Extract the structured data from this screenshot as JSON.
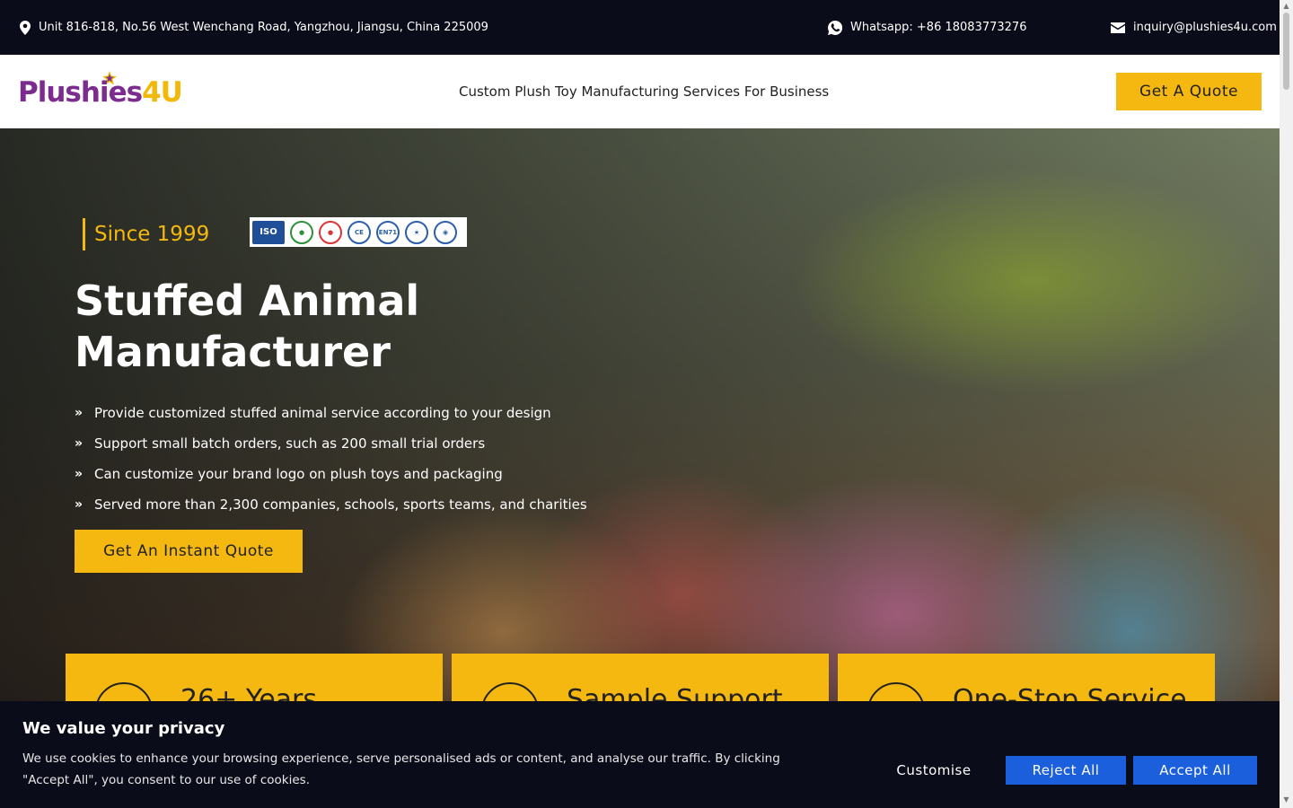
{
  "topbar": {
    "address": "Unit 816-818, No.56 West Wenchang Road, Yangzhou, Jiangsu, China 225009",
    "whatsapp": "Whatsapp: +86 18083773276",
    "email": "inquiry@plushies4u.com"
  },
  "header": {
    "logo_main": "Plushies",
    "logo_accent": "4U",
    "tagline": "Custom Plush Toy Manufacturing Services For Business",
    "quote_button": "Get A Quote"
  },
  "hero": {
    "since": "Since 1999",
    "certifications": [
      "ISO",
      "BSCI",
      "Sedex",
      "CE",
      "EN71",
      "ASTM",
      "CPSIA"
    ],
    "title_line1": "Stuffed Animal",
    "title_line2": "Manufacturer",
    "bullets": [
      "Provide customized stuffed animal service according to your design",
      "Support small batch orders, such as 200 small trial orders",
      "Can customize your brand logo on plush toys and packaging",
      "Served more than 2,300 companies, schools, sports teams, and charities"
    ],
    "cta": "Get An Instant Quote"
  },
  "features": [
    {
      "title": "26+ Years",
      "icon": "calendar-icon"
    },
    {
      "title": "Sample Support",
      "icon": "pencil-icon"
    },
    {
      "title": "One-Stop Service",
      "icon": "box-icon"
    }
  ],
  "cookie": {
    "title": "We value your privacy",
    "text": "We use cookies to enhance your browsing experience, serve personalised ads or content, and analyse our traffic. By clicking \"Accept All\", you consent to our use of cookies.",
    "customise": "Customise",
    "reject": "Reject All",
    "accept": "Accept All"
  },
  "colors": {
    "accent": "#f4b810",
    "brand_purple": "#7c2b8f",
    "dark": "#0b0c1a",
    "button_blue": "#1c5fdc"
  }
}
